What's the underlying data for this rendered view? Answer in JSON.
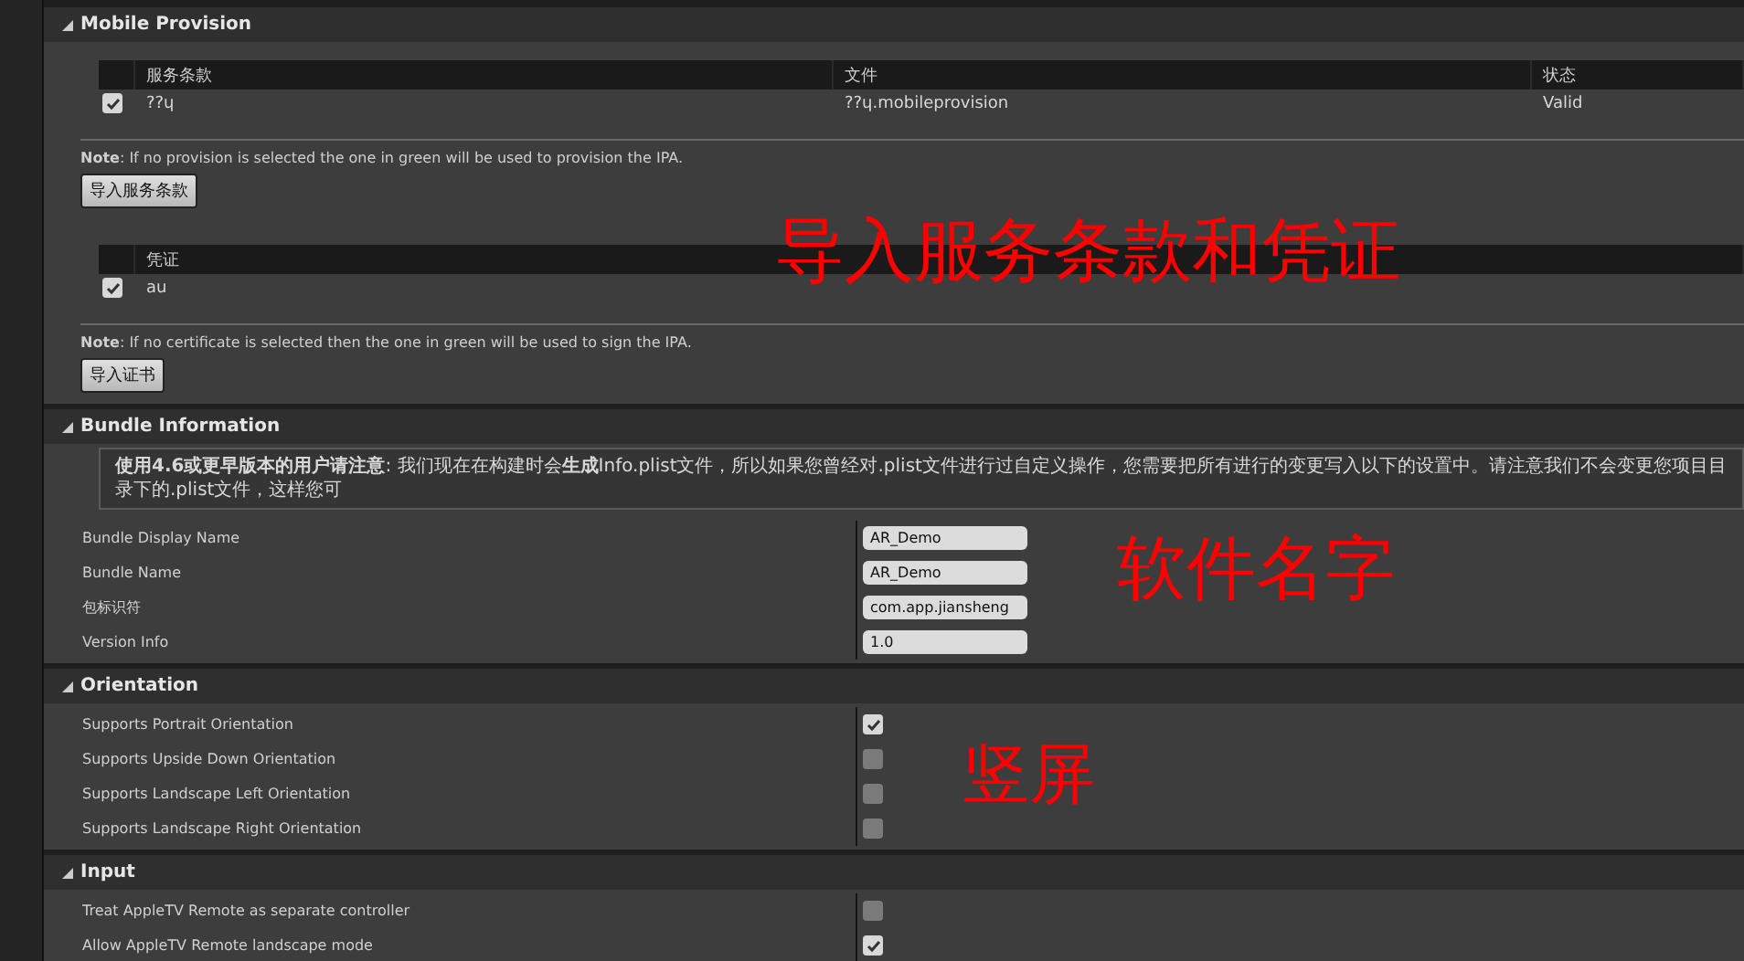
{
  "sections": [
    {
      "kind": "provision",
      "title": "Mobile Provision",
      "expanded": true,
      "provisions": {
        "columns": [
          "服务条款",
          "文件",
          "状态"
        ],
        "rows": [
          {
            "checked": true,
            "cells": [
              "??ɥ",
              "??ɥ.mobileprovision",
              "Valid"
            ]
          }
        ]
      },
      "provision_note": "**Note**: If no provision is selected the one in green will be used to provision the IPA.",
      "provision_button": "导入服务条款",
      "certificates": {
        "columns": [
          "凭证"
        ],
        "rows": [
          {
            "checked": true,
            "cells": [
              "au"
            ]
          }
        ]
      },
      "certificate_note": "**Note**: If no certificate is selected then the one in green will be used to sign the IPA.",
      "certificate_button": "导入证书",
      "annotation": "导入服务条款和凭证"
    },
    {
      "kind": "fields",
      "title": "Bundle Information",
      "expanded": true,
      "notice": "**使用4.6或更早版本的用户请注意**: 我们现在在构建时会**生成**Info.plist文件，所以如果您曾经对.plist文件进行过自定义操作，您需要把所有进行的变更写入以下的设置中。请注意我们不会变更您项目目录下的.plist文件，这样您可",
      "rows": [
        {
          "label": "Bundle Display Name",
          "value": "AR_Demo"
        },
        {
          "label": "Bundle Name",
          "value": "AR_Demo"
        },
        {
          "label": "包标识符",
          "value": "com.app.jiansheng"
        },
        {
          "label": "Version Info",
          "value": "1.0"
        }
      ],
      "annotation": "软件名字"
    },
    {
      "kind": "checks",
      "title": "Orientation",
      "expanded": true,
      "rows": [
        {
          "label": "Supports Portrait Orientation",
          "checked": true
        },
        {
          "label": "Supports Upside Down Orientation",
          "checked": false
        },
        {
          "label": "Supports Landscape Left Orientation",
          "checked": false
        },
        {
          "label": "Supports Landscape Right Orientation",
          "checked": false
        }
      ],
      "annotation": "竖屏"
    },
    {
      "kind": "checks",
      "title": "Input",
      "expanded": true,
      "rows": [
        {
          "label": "Treat AppleTV Remote as separate controller",
          "checked": false
        },
        {
          "label": "Allow AppleTV Remote landscape mode",
          "checked": true
        }
      ]
    }
  ]
}
